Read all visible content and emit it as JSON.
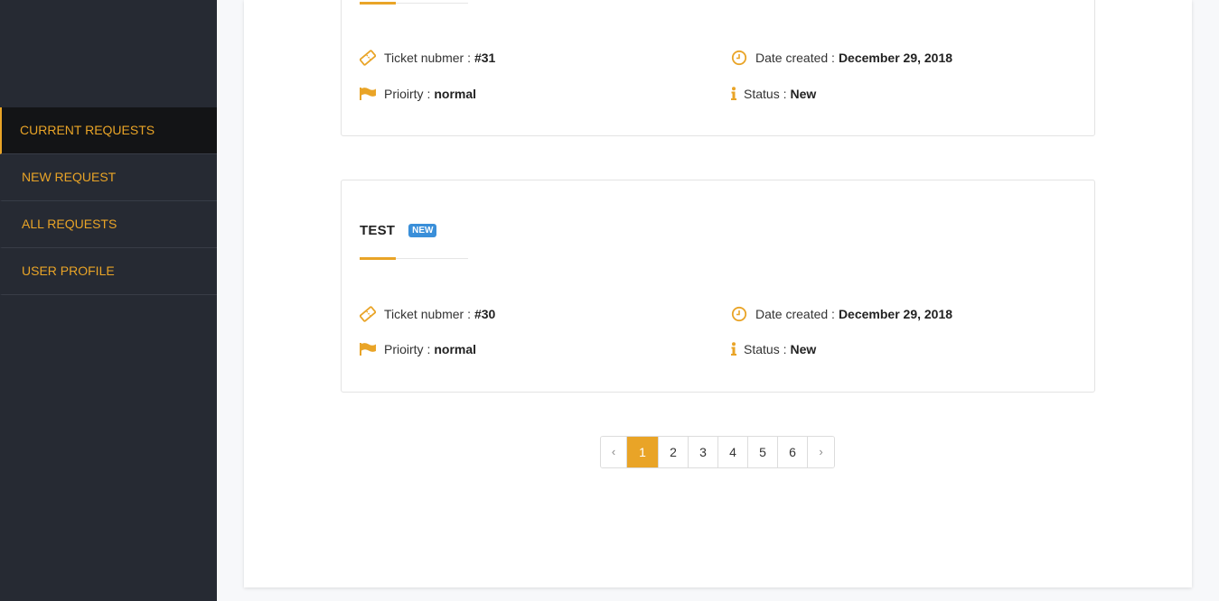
{
  "sidebar": {
    "items": [
      {
        "label": "CURRENT REQUESTS",
        "active": true
      },
      {
        "label": "NEW REQUEST"
      },
      {
        "label": "ALL REQUESTS"
      },
      {
        "label": "USER PROFILE"
      }
    ]
  },
  "colors": {
    "accent": "#e9a427",
    "sidebar_bg": "#262a33",
    "badge": "#3a8fd9"
  },
  "tickets": [
    {
      "ticket_label": "Ticket nubmer :",
      "ticket_number": "#31",
      "date_label": "Date created :",
      "date": "December 29, 2018",
      "priority_label": "Prioirty :",
      "priority": "normal",
      "status_label": "Status :",
      "status": "New"
    },
    {
      "title": "TEST",
      "badge": "NEW",
      "ticket_label": "Ticket nubmer :",
      "ticket_number": "#30",
      "date_label": "Date created :",
      "date": "December 29, 2018",
      "priority_label": "Prioirty :",
      "priority": "normal",
      "status_label": "Status :",
      "status": "New"
    }
  ],
  "pagination": {
    "prev": "‹",
    "next": "›",
    "pages": [
      "1",
      "2",
      "3",
      "4",
      "5",
      "6"
    ],
    "current": "1"
  },
  "icons": {
    "ticket": "ticket-icon",
    "clock": "clock-icon",
    "flag": "flag-icon",
    "info": "info-icon"
  }
}
